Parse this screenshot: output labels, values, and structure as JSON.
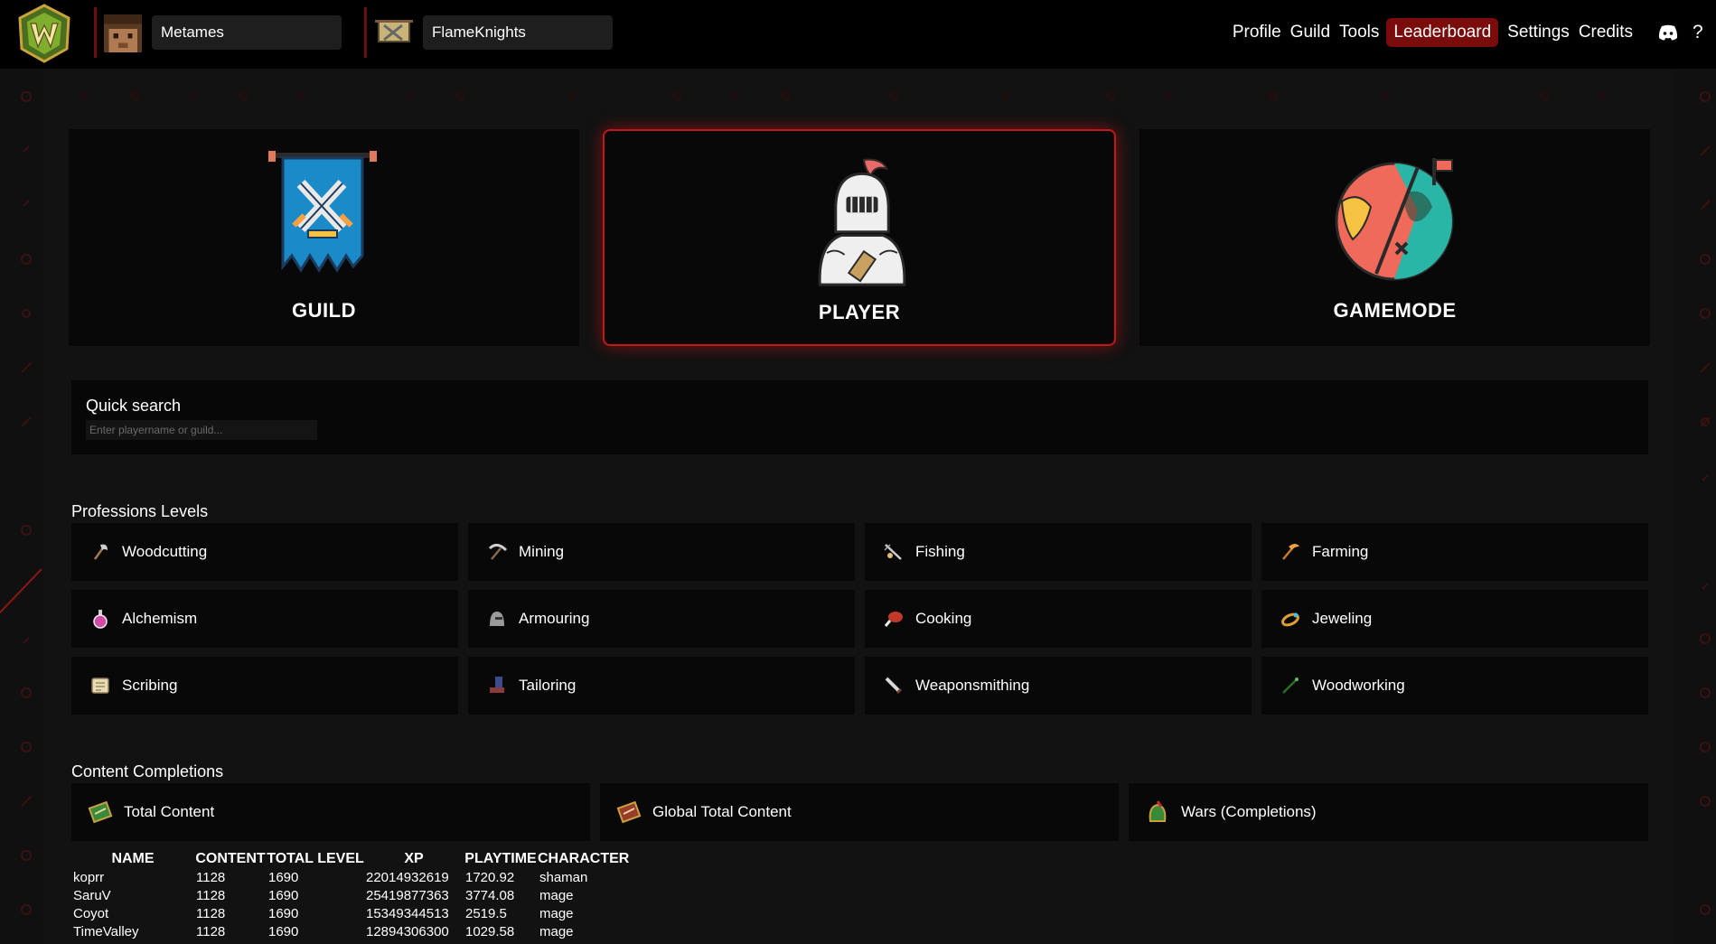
{
  "navbar": {
    "player_value": "Metames",
    "guild_value": "FlameKnights",
    "links": [
      "Profile",
      "Guild",
      "Tools",
      "Leaderboard",
      "Settings",
      "Credits"
    ],
    "active_link": "Leaderboard",
    "help_label": "?",
    "icons": {
      "logo": "wynn-logo-icon",
      "avatar": "player-avatar",
      "guild": "guild-banner-icon",
      "discord": "discord-icon"
    }
  },
  "categories": [
    {
      "label": "GUILD",
      "icon": "guild-banner-icon",
      "active": false
    },
    {
      "label": "PLAYER",
      "icon": "knight-icon",
      "active": true
    },
    {
      "label": "GAMEMODE",
      "icon": "globe-icon",
      "active": false
    }
  ],
  "quick_search": {
    "title": "Quick search",
    "placeholder": "Enter playername or guild..."
  },
  "professions": {
    "title": "Professions Levels",
    "items": [
      {
        "label": "Woodcutting",
        "icon": "axe-icon"
      },
      {
        "label": "Mining",
        "icon": "pickaxe-icon"
      },
      {
        "label": "Fishing",
        "icon": "fishing-rod-icon"
      },
      {
        "label": "Farming",
        "icon": "scythe-icon"
      },
      {
        "label": "Alchemism",
        "icon": "potion-icon"
      },
      {
        "label": "Armouring",
        "icon": "helmet-icon"
      },
      {
        "label": "Cooking",
        "icon": "meat-icon"
      },
      {
        "label": "Jeweling",
        "icon": "ring-icon"
      },
      {
        "label": "Scribing",
        "icon": "scroll-icon"
      },
      {
        "label": "Tailoring",
        "icon": "boots-icon"
      },
      {
        "label": "Weaponsmithing",
        "icon": "dagger-icon"
      },
      {
        "label": "Woodworking",
        "icon": "wand-icon"
      }
    ]
  },
  "content": {
    "title": "Content Completions",
    "items": [
      {
        "label": "Total Content",
        "icon": "book-icon"
      },
      {
        "label": "Global Total Content",
        "icon": "book-icon"
      },
      {
        "label": "Wars (Completions)",
        "icon": "war-helmet-icon"
      }
    ]
  },
  "leaderboard": {
    "headers": [
      "NAME",
      "CONTENT",
      "TOTAL LEVEL",
      "XP",
      "PLAYTIME",
      "CHARACTER"
    ],
    "rows": [
      [
        "koprr",
        "1128",
        "1690",
        "22014932619",
        "1720.92",
        "shaman"
      ],
      [
        "SaruV",
        "1128",
        "1690",
        "25419877363",
        "3774.08",
        "mage"
      ],
      [
        "Coyot",
        "1128",
        "1690",
        "15349344513",
        "2519.5",
        "mage"
      ],
      [
        "TimeValley",
        "1128",
        "1690",
        "12894306300",
        "1029.58",
        "mage"
      ]
    ]
  },
  "colors": {
    "accent": "#c01818",
    "active_nav": "#7a0c0c",
    "card_bg": "#080808"
  }
}
